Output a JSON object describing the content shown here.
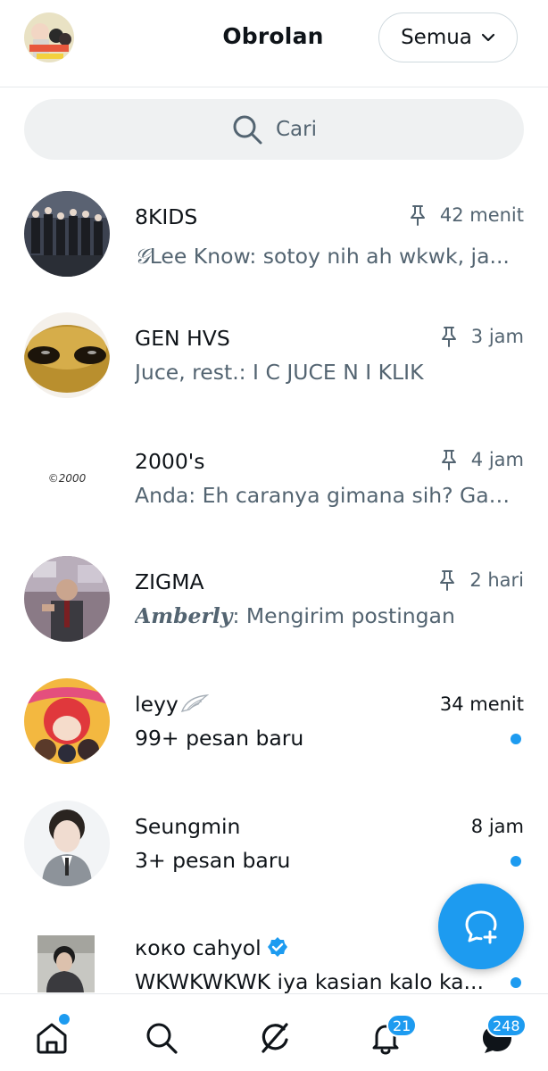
{
  "header": {
    "title": "Obrolan",
    "filter_label": "Semua"
  },
  "search": {
    "placeholder": "Cari"
  },
  "chats": [
    {
      "name": "8KIDS",
      "time": "42 menit",
      "pinned": true,
      "sender_sig": "𝒢",
      "preview": "Lee Know: sotoy nih ah wkwk, ja..."
    },
    {
      "name": "GEN HVS",
      "time": "3 jam",
      "pinned": true,
      "preview": "Juce, rest.: I C JUCE N I KLIK"
    },
    {
      "name": "2000's",
      "time": "4 jam",
      "pinned": true,
      "avatar_text": "©2000",
      "preview": "Anda: Eh caranya gimana sih? Gak ..."
    },
    {
      "name": "ZIGMA",
      "time": "2 hari",
      "pinned": true,
      "sender_sig": "Amberly",
      "preview": ": Mengirim postingan"
    },
    {
      "name": "leyy",
      "time": "34 menit",
      "pinned": false,
      "unread": true,
      "preview": "99+ pesan baru"
    },
    {
      "name": "Seungmin",
      "time": "8 jam",
      "pinned": false,
      "unread": true,
      "preview": "3+ pesan baru"
    },
    {
      "name": "кокo cahyol",
      "time": "",
      "pinned": false,
      "unread": true,
      "verified": true,
      "preview": "WKWKWKWK iya kasian kalo ka..."
    }
  ],
  "nav": {
    "notifications_badge": "21",
    "messages_badge": "248"
  },
  "colors": {
    "accent": "#1d9bf0",
    "text_primary": "#0f1419",
    "text_secondary": "#536471"
  }
}
